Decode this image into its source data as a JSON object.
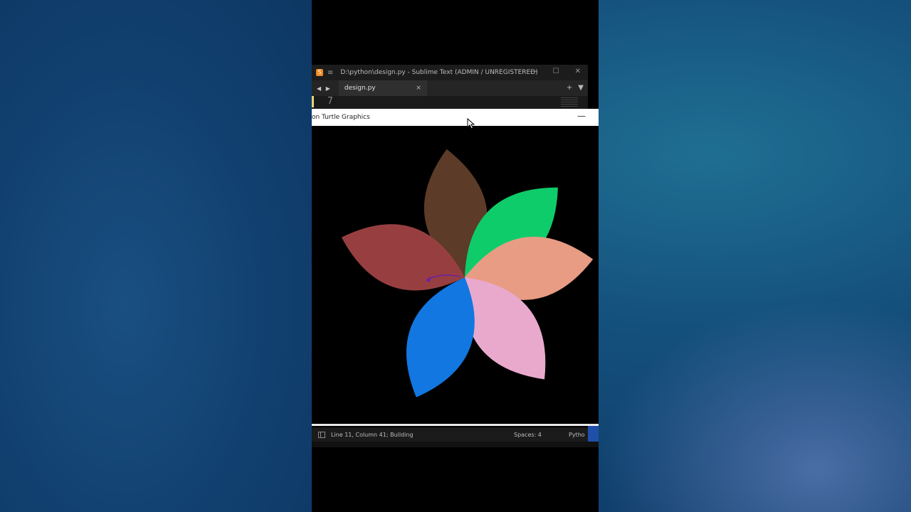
{
  "sublime": {
    "title": "D:\\python\\design.py - Sublime Text (ADMIN / UNREGISTERED)",
    "logo_glyph": "S",
    "menu_glyph": "≡",
    "min_glyph": "—",
    "max_glyph": "☐",
    "close_glyph": "✕",
    "nav_glyph": "◀ ▶",
    "tab_label": "design.py",
    "tab_close_glyph": "×",
    "new_tab_glyph": "+",
    "tab_menu_glyph": "▼",
    "line_number": "7"
  },
  "turtle": {
    "title": "on Turtle Graphics",
    "min_glyph": "—",
    "petals": [
      {
        "color": "#5c3b28"
      },
      {
        "color": "#0fcc6a"
      },
      {
        "color": "#e89c84"
      },
      {
        "color": "#e9a9cd"
      },
      {
        "color": "#1277e0"
      },
      {
        "color": "#973f40"
      }
    ],
    "pen_color": "#6a1fa8"
  },
  "statusbar": {
    "position_text": "Line 11, Column 41; Building",
    "indent_text": "Spaces: 4",
    "syntax_text": "Pytho"
  }
}
